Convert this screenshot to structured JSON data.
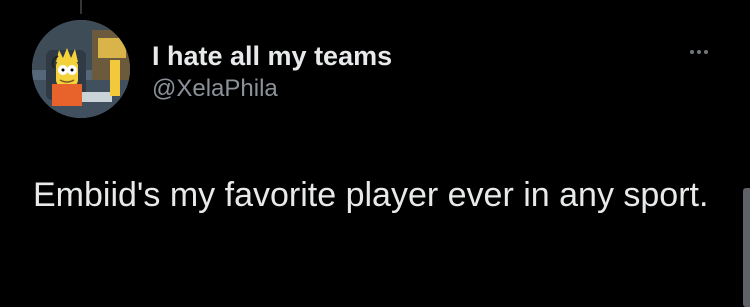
{
  "tweet": {
    "display_name": "I hate all my teams",
    "handle": "@XelaPhila",
    "text": "Embiid's my favorite player ever in any sport.",
    "avatar_description_icon": "profile-avatar",
    "more_icon": "more-options-icon"
  },
  "colors": {
    "background": "#000000",
    "primary_text": "#e7e9ea",
    "secondary_text": "#8b9299",
    "icon_gray": "#71767b"
  }
}
